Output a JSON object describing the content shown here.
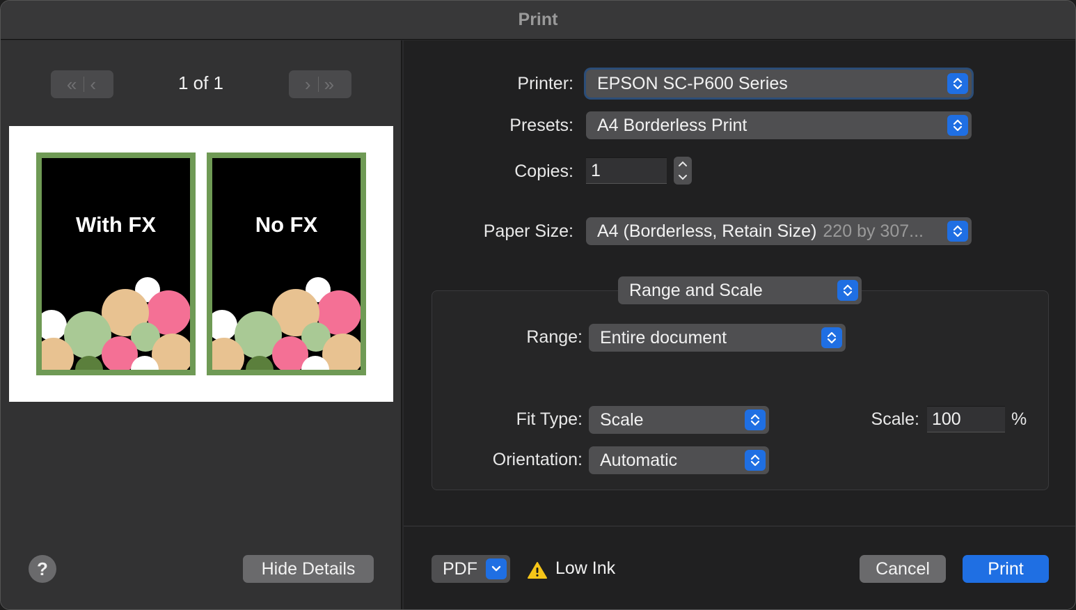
{
  "window": {
    "title": "Print"
  },
  "preview": {
    "page_indicator": "1 of 1",
    "first_page_glyph": "«",
    "prev_page_glyph": "‹",
    "next_page_glyph": "›",
    "last_page_glyph": "»",
    "cards": [
      {
        "label": "With FX"
      },
      {
        "label": "No FX"
      }
    ],
    "frame_color": "#6f9a55",
    "dot_colors": {
      "white": "#ffffff",
      "green": "#a9c995",
      "pink": "#f47095",
      "tan": "#e8c291",
      "dark_green": "#5b7f3c"
    }
  },
  "help_button": {
    "label": "?"
  },
  "hide_details_button": {
    "label": "Hide Details"
  },
  "settings": {
    "printer": {
      "label": "Printer:",
      "value": "EPSON SC-P600 Series"
    },
    "presets": {
      "label": "Presets:",
      "value": "A4 Borderless Print"
    },
    "copies": {
      "label": "Copies:",
      "value": "1"
    },
    "paper_size": {
      "label": "Paper Size:",
      "value": "A4 (Borderless, Retain Size)",
      "detail": "220 by 307..."
    },
    "section_menu": {
      "value": "Range and Scale"
    },
    "range": {
      "label": "Range:",
      "value": "Entire document"
    },
    "fit_type": {
      "label": "Fit Type:",
      "value": "Scale"
    },
    "scale": {
      "label": "Scale:",
      "value": "100",
      "unit": "%"
    },
    "orientation": {
      "label": "Orientation:",
      "value": "Automatic"
    }
  },
  "footer": {
    "pdf_button": {
      "label": "PDF"
    },
    "warning_icon": "warning-triangle",
    "status_text": "Low Ink",
    "cancel_button": {
      "label": "Cancel"
    },
    "print_button": {
      "label": "Print"
    }
  },
  "colors": {
    "accent": "#1f6fe3",
    "warning": "#f5c518"
  }
}
